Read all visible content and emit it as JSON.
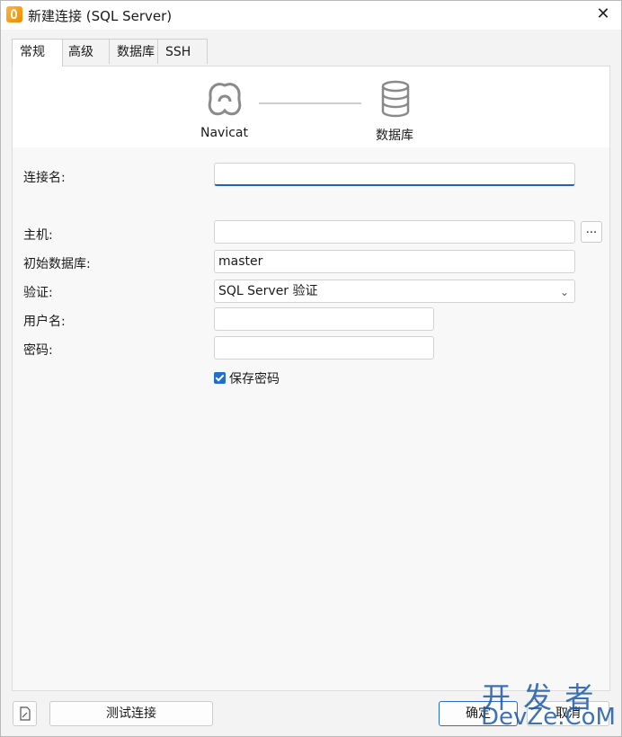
{
  "window": {
    "title": "新建连接 (SQL Server)",
    "close_glyph": "✕"
  },
  "tabs": [
    {
      "label": "常规",
      "active": true
    },
    {
      "label": "高级",
      "active": false
    },
    {
      "label": "数据库",
      "active": false
    },
    {
      "label": "SSH",
      "active": false
    }
  ],
  "banner": {
    "left_label": "Navicat",
    "right_label": "数据库"
  },
  "form": {
    "connection_name": {
      "label": "连接名:",
      "value": ""
    },
    "host": {
      "label": "主机:",
      "value": "",
      "browse_label": "..."
    },
    "initial_database": {
      "label": "初始数据库:",
      "value": "master"
    },
    "auth": {
      "label": "验证:",
      "value": "SQL Server 验证"
    },
    "username": {
      "label": "用户名:",
      "value": ""
    },
    "password": {
      "label": "密码:",
      "value": ""
    },
    "save_password": {
      "label": "保存密码",
      "checked": true
    }
  },
  "buttons": {
    "test": "测试连接",
    "ok": "确定",
    "cancel": "取消"
  },
  "watermark": {
    "line1": "开 发 者",
    "line2": "DevZe.CoM"
  },
  "colors": {
    "accent": "#1f6fcb",
    "focus_underline": "#1a62c5",
    "icon_orange": "#f5a623"
  }
}
